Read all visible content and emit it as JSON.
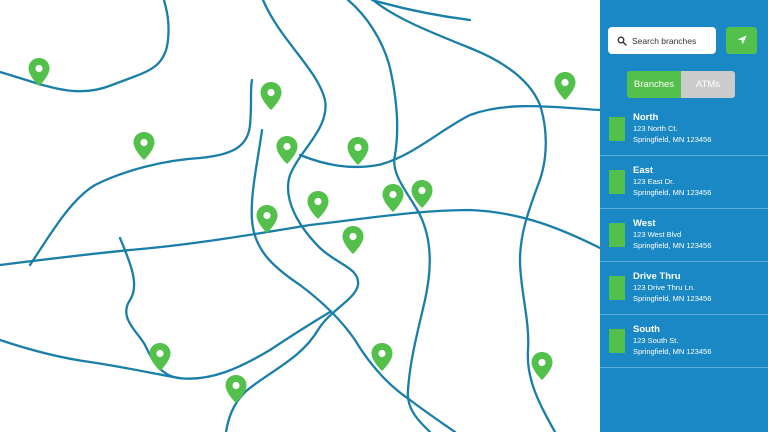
{
  "search": {
    "placeholder": "Search branches"
  },
  "icons": {
    "search": "search-icon",
    "locate": "location-arrow-icon",
    "pin": "map-pin-icon"
  },
  "tabs": [
    {
      "label": "Branches",
      "active": true
    },
    {
      "label": "ATMs",
      "active": false
    }
  ],
  "branches": [
    {
      "name": "North",
      "address": "123 North Ct.",
      "city": "Springfield, MN 123456"
    },
    {
      "name": "East",
      "address": "123 East Dr.",
      "city": "Springfield, MN 123456"
    },
    {
      "name": "West",
      "address": "123 West Blvd",
      "city": "Springfield, MN 123456"
    },
    {
      "name": "Drive Thru",
      "address": "123 Drive Thru Ln.",
      "city": "Springfield, MN 123456"
    },
    {
      "name": "South",
      "address": "123 South St.",
      "city": "Springfield, MN 123456"
    }
  ],
  "colors": {
    "panel": "#1a88c4",
    "accent": "#52c04a",
    "road": "#1a7fa8",
    "tab_inactive": "#cccccc"
  }
}
